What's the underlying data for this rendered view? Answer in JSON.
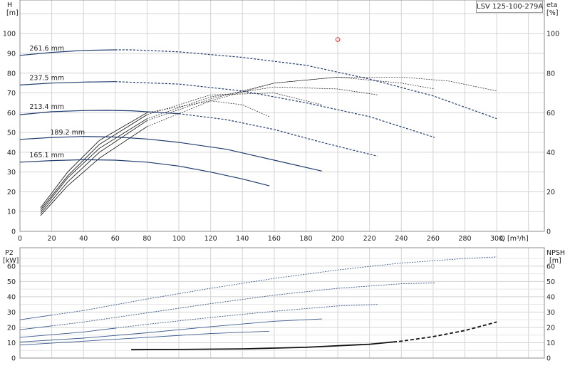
{
  "chart_data": [
    {
      "type": "line",
      "panel": "head-efficiency",
      "title": "LSV 125-100-279A",
      "xlabel": "Q [m³/h]",
      "ylabel": "H [m]",
      "ylabel_parts": [
        "H",
        "[m]"
      ],
      "y2label_parts": [
        "eta",
        "[%]"
      ],
      "xlim": [
        0,
        330
      ],
      "ylim": [
        0,
        117
      ],
      "y2lim": [
        0,
        117
      ],
      "xticks": [
        0,
        20,
        40,
        60,
        80,
        100,
        120,
        140,
        160,
        180,
        200,
        220,
        240,
        260,
        280,
        300
      ],
      "yticks": [
        0,
        10,
        20,
        30,
        40,
        50,
        60,
        70,
        80,
        90,
        100
      ],
      "y2ticks": [
        0,
        20,
        40,
        60,
        80,
        100
      ],
      "grid": true,
      "marker_point": {
        "x": 200,
        "y": 97,
        "color": "#e03030"
      },
      "head_series": [
        {
          "name": "261.6 mm",
          "label_at": [
            6,
            91.5
          ],
          "solid_until": 60,
          "x": [
            0,
            20,
            40,
            60,
            70,
            100,
            140,
            180,
            220,
            260,
            300
          ],
          "y": [
            89,
            90.5,
            91.5,
            91.8,
            91.8,
            90.8,
            88,
            84,
            77,
            68.5,
            57
          ]
        },
        {
          "name": "237.5 mm",
          "label_at": [
            6,
            76.5
          ],
          "solid_until": 60,
          "x": [
            0,
            20,
            40,
            60,
            100,
            140,
            180,
            220,
            261
          ],
          "y": [
            74,
            75,
            75.5,
            75.7,
            74.5,
            71,
            65,
            58,
            47.5
          ]
        },
        {
          "name": "213.4 mm",
          "label_at": [
            6,
            62
          ],
          "solid_until": 100,
          "x": [
            0,
            20,
            40,
            55,
            70,
            100,
            130,
            160,
            190,
            225
          ],
          "y": [
            59,
            60.5,
            61.1,
            61.2,
            61,
            59.5,
            56.5,
            51.5,
            45,
            38
          ]
        },
        {
          "name": "189.2 mm",
          "label_at": [
            19,
            49
          ],
          "solid_until": 190,
          "x": [
            0,
            20,
            40,
            60,
            80,
            100,
            130,
            160,
            190
          ],
          "y": [
            46.5,
            47.5,
            48,
            47.7,
            46.7,
            45,
            41.5,
            36,
            30.5
          ]
        },
        {
          "name": "165.1 mm",
          "label_at": [
            6,
            37.5
          ],
          "solid_until": 157,
          "x": [
            0,
            20,
            40,
            60,
            80,
            100,
            120,
            140,
            157
          ],
          "y": [
            35,
            35.8,
            36.2,
            36,
            35,
            33,
            30,
            26.5,
            23
          ]
        }
      ],
      "eta_series": [
        {
          "impeller": "261.6 mm",
          "x": [
            13,
            30,
            50,
            80,
            120,
            160,
            200,
            240,
            270,
            300
          ],
          "y": [
            8,
            23,
            37,
            53,
            66,
            75,
            78,
            78,
            76,
            71
          ]
        },
        {
          "impeller": "237.5 mm",
          "x": [
            13,
            30,
            50,
            80,
            120,
            160,
            200,
            240,
            261
          ],
          "y": [
            9,
            25,
            40,
            56,
            67,
            75,
            78,
            75,
            72
          ]
        },
        {
          "impeller": "213.4 mm",
          "x": [
            13,
            30,
            50,
            80,
            120,
            160,
            200,
            225
          ],
          "y": [
            10,
            27,
            42,
            57,
            68,
            73,
            72,
            69
          ]
        },
        {
          "impeller": "189.2 mm",
          "x": [
            13,
            30,
            50,
            80,
            120,
            160,
            190
          ],
          "y": [
            11,
            28,
            44,
            59,
            69,
            70,
            64
          ]
        },
        {
          "impeller": "165.1 mm",
          "x": [
            13,
            30,
            50,
            80,
            120,
            140,
            157
          ],
          "y": [
            12,
            30,
            46,
            60,
            66,
            64,
            58
          ]
        }
      ]
    },
    {
      "type": "line",
      "panel": "power-npsh",
      "xlim": [
        0,
        330
      ],
      "ylim": [
        0,
        72
      ],
      "y2lim": [
        0,
        72
      ],
      "ylabel_parts": [
        "P2",
        "[kW]"
      ],
      "y2label_parts": [
        "NPSH",
        "[m]"
      ],
      "xticks": [
        0,
        20,
        40,
        60,
        80,
        100,
        120,
        140,
        160,
        180,
        200,
        220,
        240,
        260,
        280,
        300
      ],
      "yticks": [
        0,
        10,
        20,
        30,
        40,
        50,
        60
      ],
      "y2ticks": [
        0,
        10,
        20,
        30,
        40,
        50,
        60
      ],
      "grid": true,
      "power_series": [
        {
          "impeller": "261.6 mm",
          "solid_until": 20,
          "x": [
            0,
            40,
            80,
            120,
            160,
            200,
            240,
            280,
            300
          ],
          "y": [
            25,
            31,
            38.5,
            45.5,
            52,
            57.5,
            62,
            65,
            66
          ]
        },
        {
          "impeller": "237.5 mm",
          "solid_until": 20,
          "x": [
            0,
            40,
            80,
            120,
            160,
            200,
            240,
            261
          ],
          "y": [
            18.5,
            23.5,
            29.5,
            35.5,
            41,
            45.5,
            48.5,
            49
          ]
        },
        {
          "impeller": "213.4 mm",
          "solid_until": 60,
          "x": [
            0,
            40,
            80,
            120,
            160,
            200,
            225
          ],
          "y": [
            13.5,
            17,
            22,
            26.5,
            30.5,
            34,
            35
          ]
        },
        {
          "impeller": "189.2 mm",
          "solid_until": 190,
          "x": [
            0,
            40,
            80,
            120,
            160,
            190
          ],
          "y": [
            10.5,
            13,
            16.5,
            20.5,
            24,
            25.5
          ]
        },
        {
          "impeller": "165.1 mm",
          "solid_until": 157,
          "x": [
            0,
            40,
            80,
            120,
            157
          ],
          "y": [
            8.5,
            11,
            13.5,
            16,
            17.5
          ]
        }
      ],
      "npsh_series": {
        "solid_until": 235,
        "x": [
          70,
          100,
          140,
          180,
          220,
          240,
          260,
          280,
          300
        ],
        "y": [
          5.5,
          5.6,
          6,
          7,
          9,
          11,
          14,
          18,
          23.5
        ]
      }
    }
  ]
}
